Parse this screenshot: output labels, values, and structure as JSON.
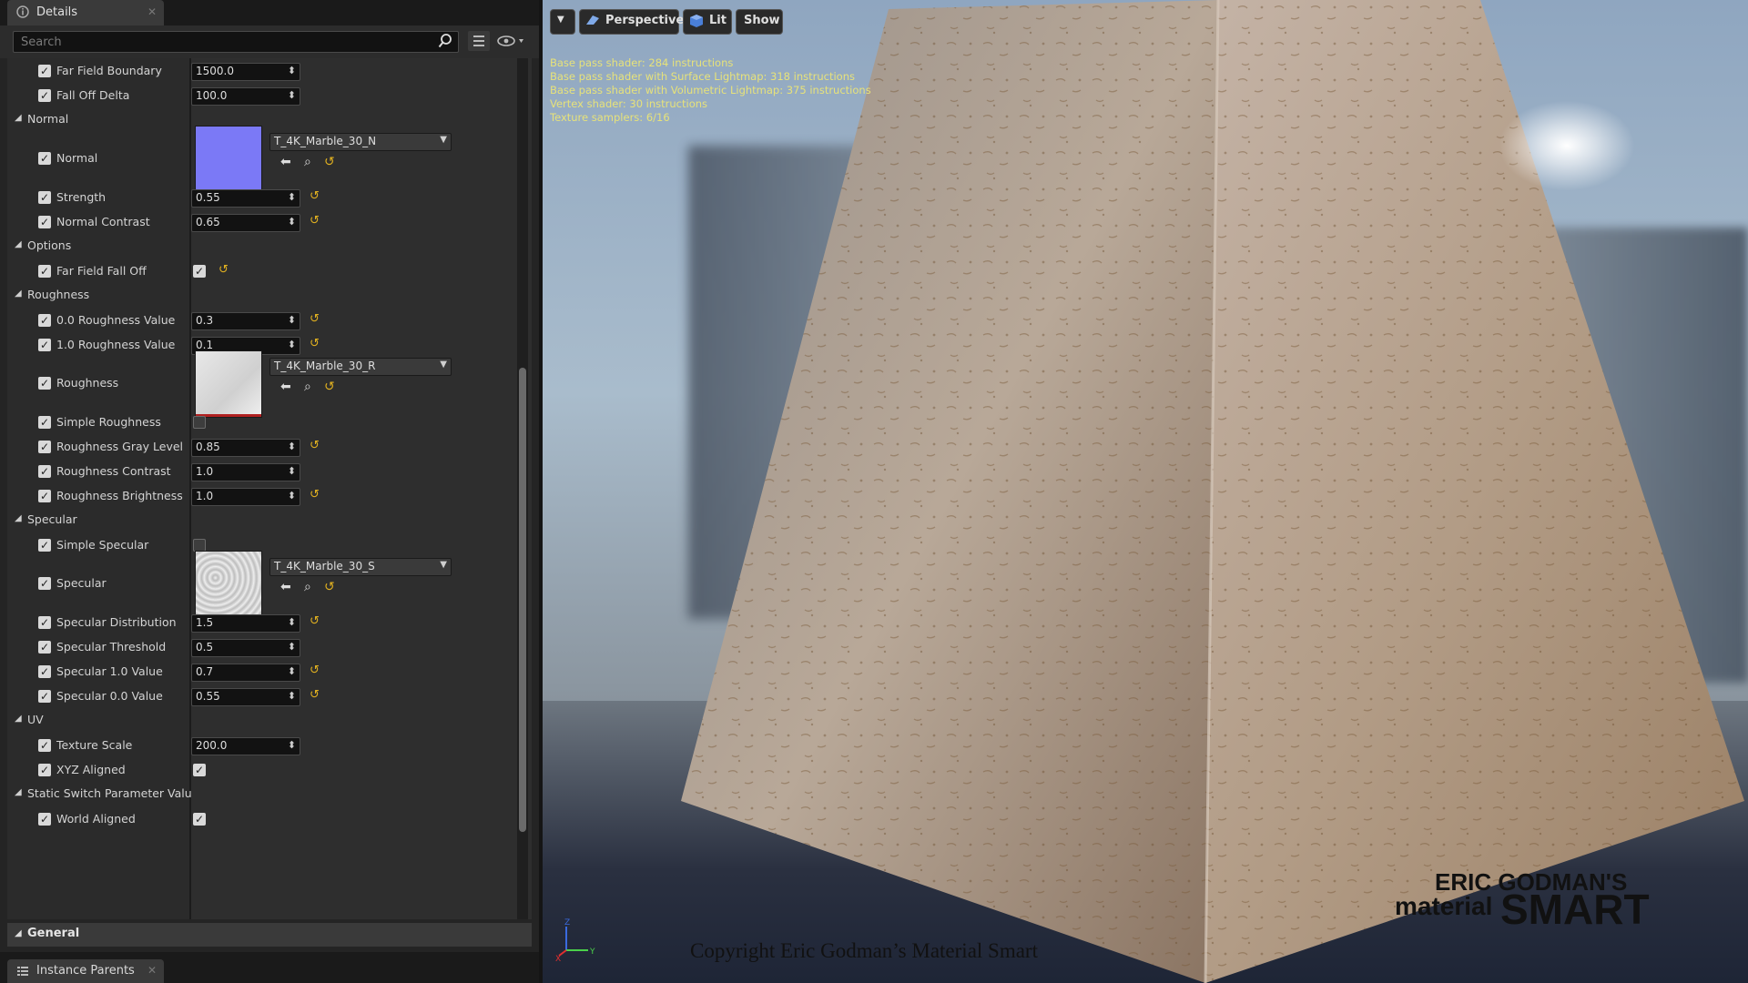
{
  "details": {
    "tab_label": "Details",
    "search_placeholder": "Search",
    "rows": [
      {
        "kind": "param",
        "name": "Far Field Boundary",
        "value": "1500.0",
        "reset": false
      },
      {
        "kind": "param",
        "name": "Fall Off Delta",
        "value": "100.0",
        "reset": false
      },
      {
        "kind": "category",
        "name": "Normal"
      },
      {
        "kind": "texture",
        "name": "Normal",
        "texture": "T_4K_Marble_30_N",
        "thumb": "normal"
      },
      {
        "kind": "param",
        "name": "Strength",
        "value": "0.55",
        "reset": true
      },
      {
        "kind": "param",
        "name": "Normal Contrast",
        "value": "0.65",
        "reset": true
      },
      {
        "kind": "category",
        "name": "Options"
      },
      {
        "kind": "checkbox",
        "name": "Far Field Fall Off",
        "checked": true,
        "reset": true
      },
      {
        "kind": "category",
        "name": "Roughness"
      },
      {
        "kind": "param",
        "name": "0.0 Roughness Value",
        "value": "0.3",
        "reset": true
      },
      {
        "kind": "param",
        "name": "1.0 Roughness Value",
        "value": "0.1",
        "reset": true
      },
      {
        "kind": "texture",
        "name": "Roughness",
        "texture": "T_4K_Marble_30_R",
        "thumb": "rough"
      },
      {
        "kind": "checkbox",
        "name": "Simple Roughness",
        "checked": false,
        "reset": false
      },
      {
        "kind": "param",
        "name": "Roughness Gray Level",
        "value": "0.85",
        "reset": true
      },
      {
        "kind": "param",
        "name": "Roughness Contrast",
        "value": "1.0",
        "reset": false
      },
      {
        "kind": "param",
        "name": "Roughness Brightness",
        "value": "1.0",
        "reset": true
      },
      {
        "kind": "category",
        "name": "Specular"
      },
      {
        "kind": "checkbox",
        "name": "Simple Specular",
        "checked": false,
        "reset": false
      },
      {
        "kind": "texture",
        "name": "Specular",
        "texture": "T_4K_Marble_30_S",
        "thumb": "spec"
      },
      {
        "kind": "param",
        "name": "Specular Distribution",
        "value": "1.5",
        "reset": true
      },
      {
        "kind": "param",
        "name": "Specular Threshold",
        "value": "0.5",
        "reset": false
      },
      {
        "kind": "param",
        "name": "Specular 1.0 Value",
        "value": "0.7",
        "reset": true
      },
      {
        "kind": "param",
        "name": "Specular 0.0 Value",
        "value": "0.55",
        "reset": true
      },
      {
        "kind": "category",
        "name": "UV"
      },
      {
        "kind": "param",
        "name": "Texture Scale",
        "value": "200.0",
        "reset": false
      },
      {
        "kind": "checkbox",
        "name": "XYZ Aligned",
        "checked": true,
        "reset": false
      },
      {
        "kind": "category",
        "name": "Static Switch Parameter Valu"
      },
      {
        "kind": "checkbox",
        "name": "World Aligned",
        "checked": true,
        "reset": false
      }
    ],
    "general_label": "General",
    "bottom_tab_label": "Instance Parents"
  },
  "viewport": {
    "perspective_label": "Perspective",
    "lit_label": "Lit",
    "show_label": "Show",
    "stats": [
      "Base pass shader: 284 instructions",
      "Base pass shader with Surface Lightmap: 318 instructions",
      "Base pass shader with Volumetric Lightmap: 375 instructions",
      "Vertex shader: 30 instructions",
      "Texture samplers: 6/16"
    ],
    "watermark_line1": "ERIC GODMAN'S",
    "watermark_material": "material",
    "watermark_smart": "SMART",
    "copyright": "Copyright Eric Godman’s Material Smart",
    "axis_z": "Z",
    "axis_y": "Y",
    "axis_x": "X"
  },
  "colors": {
    "panel_bg": "#2e2e2e",
    "reset_arrow": "#e0b020",
    "stats_text": "#e7e27a",
    "normal_thumb": "#7b79f6"
  }
}
